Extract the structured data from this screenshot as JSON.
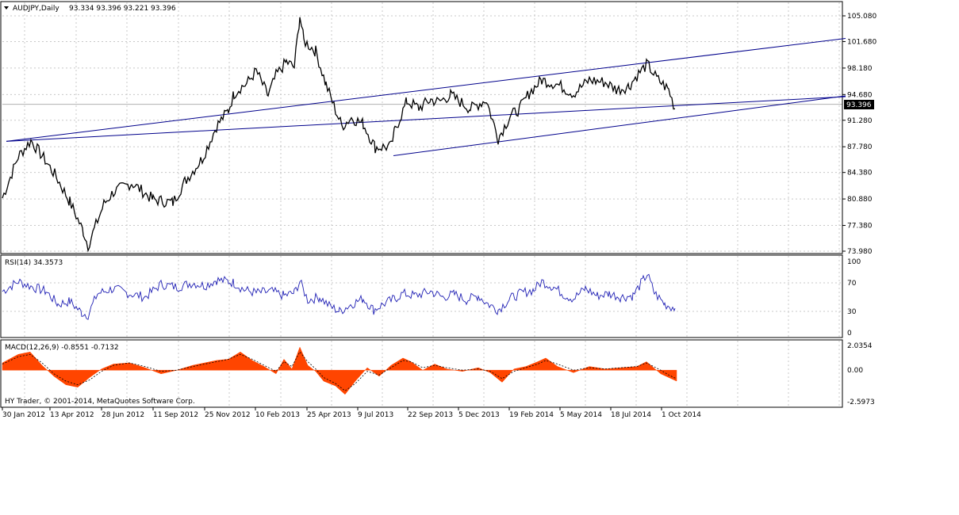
{
  "header": {
    "symbol_title": "AUDJPY,Daily",
    "ohlc_text": "93.334 93.396 93.221 93.396"
  },
  "watermark": "HY Trader, © 2001-2014, MetaQuotes Software Corp.",
  "current_price": "93.396",
  "chart_data": [
    {
      "type": "line",
      "panel": "price",
      "title": "AUDJPY,Daily",
      "y_ticks": [
        "105.080",
        "101.680",
        "98.180",
        "94.680",
        "91.280",
        "87.780",
        "84.380",
        "80.880",
        "77.380",
        "73.980"
      ],
      "ylim": [
        73.98,
        105.08
      ],
      "x_ticks": [
        "30 Jan 2012",
        "13 Apr 2012",
        "28 Jun 2012",
        "11 Sep 2012",
        "25 Nov 2012",
        "10 Feb 2013",
        "25 Apr 2013",
        "9 Jul 2013",
        "22 Sep 2013",
        "5 Dec 2013",
        "19 Feb 2014",
        "5 May 2014",
        "18 Jul 2014",
        "1 Oct 2014"
      ],
      "x": [
        0,
        20,
        36,
        54,
        68,
        85,
        102,
        108,
        128,
        140,
        163,
        190,
        215,
        230,
        252,
        270,
        285,
        292,
        300,
        308,
        320,
        335,
        345,
        358,
        368,
        375,
        380,
        395,
        408,
        420,
        428,
        440,
        455,
        470,
        490,
        495,
        510,
        525,
        540,
        550,
        565,
        590,
        610,
        625,
        640,
        652,
        665,
        680,
        700,
        720,
        740,
        760,
        775,
        790,
        800,
        813,
        825,
        840,
        848
      ],
      "values": [
        81.0,
        86.5,
        88.6,
        86.0,
        83.8,
        80.5,
        76.6,
        74.7,
        80.2,
        81.8,
        83.0,
        80.8,
        80.4,
        83.2,
        86.2,
        90.5,
        92.6,
        94.8,
        95.6,
        96.1,
        97.8,
        94.5,
        97.2,
        99.0,
        98.3,
        105.1,
        101.8,
        100.4,
        96.0,
        92.6,
        90.5,
        91.6,
        90.8,
        87.7,
        87.8,
        90.0,
        93.8,
        92.9,
        94.0,
        93.7,
        94.6,
        92.8,
        94.0,
        88.9,
        91.8,
        92.8,
        95.0,
        96.6,
        96.0,
        94.8,
        96.6,
        96.3,
        95.3,
        95.8,
        97.2,
        98.7,
        96.8,
        95.3,
        92.8
      ],
      "trendlines": [
        {
          "x": [
            5,
            1063
          ],
          "values": [
            88.5,
            102.1
          ]
        },
        {
          "x": [
            5,
            1063
          ],
          "values": [
            88.5,
            94.4
          ]
        },
        {
          "x": [
            493,
            1063
          ],
          "values": [
            86.6,
            94.5
          ]
        }
      ]
    },
    {
      "type": "line",
      "panel": "rsi",
      "title": "RSI(14) 34.3573",
      "y_ticks": [
        "100",
        "70",
        "30",
        "0"
      ],
      "ylim": [
        0,
        100
      ],
      "x": [
        0,
        20,
        36,
        55,
        70,
        85,
        100,
        108,
        120,
        140,
        160,
        180,
        200,
        220,
        240,
        255,
        270,
        285,
        292,
        305,
        320,
        340,
        355,
        368,
        375,
        385,
        400,
        412,
        425,
        440,
        455,
        468,
        480,
        495,
        505,
        520,
        540,
        555,
        570,
        585,
        600,
        610,
        625,
        640,
        655,
        670,
        680,
        695,
        710,
        720,
        735,
        750,
        765,
        780,
        795,
        808,
        813,
        822,
        835,
        848
      ],
      "values": [
        58,
        72,
        65,
        58,
        40,
        44,
        28,
        25,
        55,
        62,
        55,
        50,
        68,
        64,
        70,
        66,
        74,
        72,
        70,
        60,
        56,
        58,
        52,
        56,
        72,
        46,
        50,
        38,
        30,
        40,
        48,
        32,
        40,
        48,
        55,
        52,
        58,
        50,
        54,
        46,
        52,
        42,
        32,
        48,
        56,
        60,
        72,
        64,
        52,
        48,
        62,
        52,
        55,
        50,
        52,
        74,
        82,
        56,
        40,
        34.36
      ]
    },
    {
      "type": "area",
      "panel": "macd",
      "title": "MACD(12,26,9) -0.8551 -0.7132",
      "y_ticks": [
        "2.0354",
        "0.00",
        "-2.5973"
      ],
      "ylim": [
        -2.5973,
        2.0354
      ],
      "x": [
        0,
        20,
        35,
        50,
        65,
        80,
        95,
        110,
        125,
        140,
        160,
        180,
        200,
        220,
        240,
        255,
        270,
        285,
        300,
        315,
        330,
        345,
        355,
        365,
        375,
        385,
        395,
        405,
        420,
        432,
        445,
        460,
        475,
        490,
        505,
        515,
        530,
        545,
        560,
        580,
        600,
        615,
        630,
        645,
        660,
        675,
        685,
        700,
        720,
        740,
        760,
        780,
        800,
        812,
        830,
        840,
        850
      ],
      "values": [
        0.6,
        1.3,
        1.5,
        0.4,
        -0.5,
        -1.2,
        -1.4,
        -0.6,
        0.1,
        0.5,
        0.6,
        0.2,
        -0.3,
        0.0,
        0.4,
        0.6,
        0.8,
        0.9,
        1.5,
        0.8,
        0.3,
        -0.3,
        0.9,
        0.1,
        1.9,
        0.4,
        -0.1,
        -0.9,
        -1.3,
        -2.0,
        -0.9,
        0.2,
        -0.5,
        0.4,
        1.0,
        0.7,
        0.0,
        0.5,
        0.1,
        -0.1,
        0.2,
        -0.2,
        -1.0,
        0.1,
        0.3,
        0.7,
        1.0,
        0.3,
        -0.2,
        0.3,
        0.1,
        0.2,
        0.3,
        0.7,
        -0.3,
        -0.6,
        -0.9
      ],
      "signal": [
        0.5,
        1.1,
        1.3,
        0.6,
        -0.3,
        -0.9,
        -1.2,
        -0.8,
        -0.1,
        0.4,
        0.6,
        0.3,
        -0.1,
        0.0,
        0.3,
        0.5,
        0.7,
        0.9,
        1.3,
        0.9,
        0.4,
        -0.1,
        0.7,
        0.3,
        1.5,
        0.7,
        0.1,
        -0.6,
        -1.1,
        -1.7,
        -1.1,
        -0.1,
        -0.4,
        0.2,
        0.8,
        0.7,
        0.2,
        0.4,
        0.2,
        0.0,
        0.1,
        -0.1,
        -0.7,
        -0.1,
        0.2,
        0.5,
        0.8,
        0.5,
        0.0,
        0.2,
        0.1,
        0.2,
        0.3,
        0.6,
        0.0,
        -0.4,
        -0.71
      ]
    }
  ],
  "colors": {
    "price_line": "#000000",
    "trendline": "#00008b",
    "rsi_line": "#1f1fb4",
    "macd_fill": "#ff4500",
    "signal_line": "#000000",
    "grid": "#c8c8c8"
  }
}
